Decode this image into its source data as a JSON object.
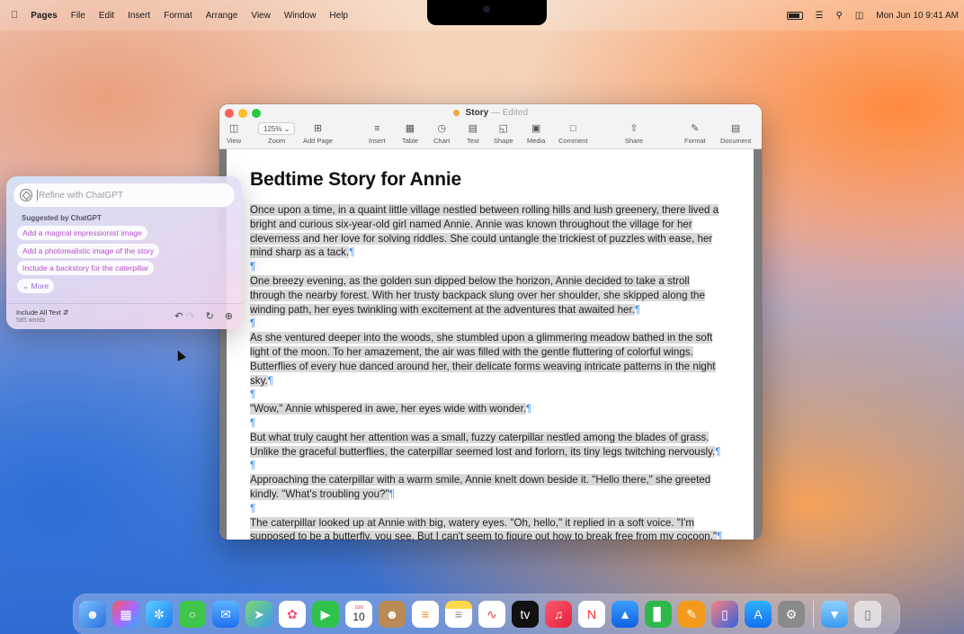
{
  "menubar": {
    "app_name": "Pages",
    "items": [
      "File",
      "Edit",
      "Insert",
      "Format",
      "Arrange",
      "View",
      "Window",
      "Help"
    ],
    "clock": "Mon Jun 10  9:41 AM"
  },
  "window": {
    "doc_name": "Story",
    "separator": "—",
    "status": "Edited",
    "toolbar": {
      "view": "View",
      "zoom_value": "125%",
      "zoom": "Zoom",
      "add_page": "Add Page",
      "insert": "Insert",
      "table": "Table",
      "chart": "Chart",
      "text": "Text",
      "shape": "Shape",
      "media": "Media",
      "comment": "Comment",
      "share": "Share",
      "format": "Format",
      "document": "Document"
    }
  },
  "document": {
    "title": "Bedtime Story for Annie",
    "pilcrow": "¶",
    "paragraphs": [
      "Once upon a time, in a quaint little village nestled between rolling hills and lush greenery, there lived a bright and curious six-year-old girl named Annie. Annie was known throughout the village for her cleverness and her love for solving riddles. She could untangle the trickiest of puzzles with ease, her mind sharp as a tack.",
      "One breezy evening, as the golden sun dipped below the horizon, Annie decided to take a stroll through the nearby forest. With her trusty backpack slung over her shoulder, she skipped along the winding path, her eyes twinkling with excitement at the adventures that awaited her.",
      "As she ventured deeper into the woods, she stumbled upon a glimmering meadow bathed in the soft light of the moon. To her amazement, the air was filled with the gentle fluttering of colorful wings. Butterflies of every hue danced around her, their delicate forms weaving intricate patterns in the night sky.",
      "\"Wow,\" Annie whispered in awe, her eyes wide with wonder.",
      "But what truly caught her attention was a small, fuzzy caterpillar nestled among the blades of grass. Unlike the graceful butterflies, the caterpillar seemed lost and forlorn, its tiny legs twitching nervously.",
      "Approaching the caterpillar with a warm smile, Annie knelt down beside it. \"Hello there,\" she greeted kindly. \"What's troubling you?\"",
      "The caterpillar looked up at Annie with big, watery eyes. \"Oh, hello,\" it replied in a soft voice. \"I'm supposed to be a butterfly, you see. But I can't seem to figure out how to break free from my cocoon.\""
    ]
  },
  "chatgpt_panel": {
    "placeholder": "Refine with ChatGPT",
    "suggested_label": "Suggested by ChatGPT",
    "suggestions": [
      "Add a magical impressionist image",
      "Add a photorealistic image of the story",
      "Include a backstory for the caterpillar"
    ],
    "more_label": "More",
    "include_label": "Include All Text",
    "word_count": "585 words"
  },
  "dock": {
    "calendar_month": "JUN",
    "calendar_day": "10"
  }
}
